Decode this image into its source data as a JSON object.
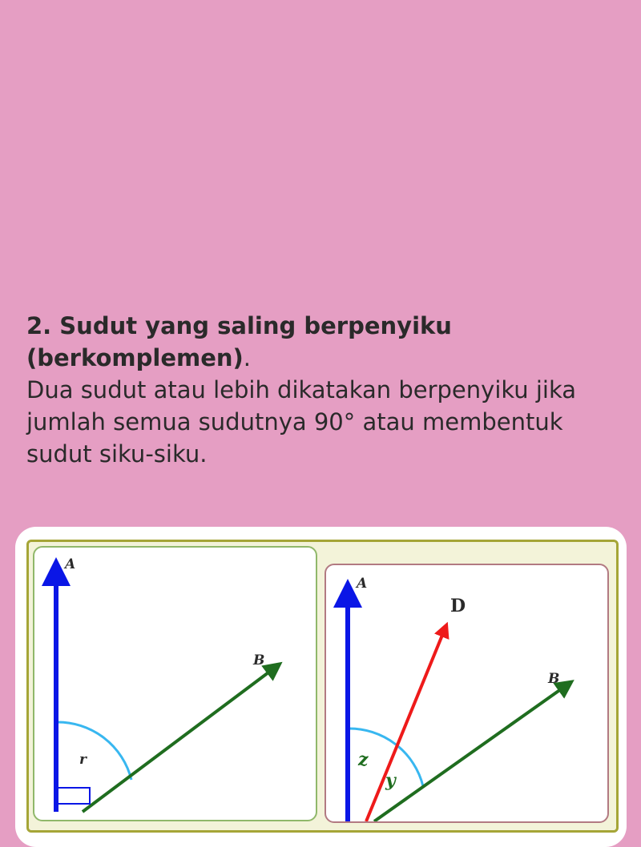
{
  "heading": {
    "text": "2. Sudut yang saling berpenyiku (berkomplemen)",
    "period": "."
  },
  "body_text": "Dua sudut atau lebih dikatakan berpenyiku jika jumlah semua sudutnya 90° atau membentuk sudut siku-siku.",
  "diagram": {
    "left": {
      "ray_vertical_label": "A",
      "ray_oblique_label": "B",
      "angle_label": "r"
    },
    "right": {
      "ray_vertical_label": "A",
      "ray_middle_label": "D",
      "ray_oblique_label": "B",
      "angle_labels": [
        "z",
        "y"
      ]
    },
    "colors": {
      "ray_vertical": "#0a16e6",
      "ray_oblique": "#1f6d1f",
      "ray_middle": "#ee1a1a",
      "arc": "#38b7f0",
      "label_dark": "#2a2a2a",
      "label_green": "#1f6d1f"
    }
  }
}
